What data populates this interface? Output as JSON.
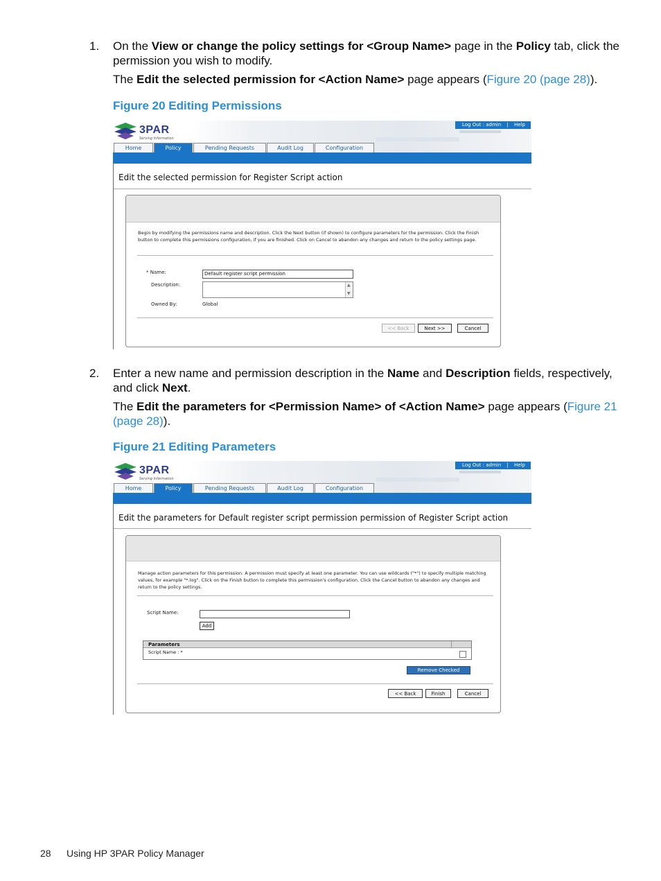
{
  "step1": {
    "num": "1.",
    "t1": "On the ",
    "b1": "View or change the policy settings for <Group Name>",
    "t2": " page in the ",
    "b2": "Policy",
    "t3": " tab, click the",
    "line2": "permission you wish to modify.",
    "r_t1": "The ",
    "r_b1": "Edit the selected permission for <Action Name>",
    "r_t2": " page appears (",
    "r_link": "Figure 20 (page 28)",
    "r_t3": ")."
  },
  "fig20": {
    "caption": "Figure 20 Editing Permissions",
    "logo_text": "3PAR",
    "logo_tag": "Serving Information",
    "toplinks": {
      "logout": "Log Out : admin",
      "divider": "|",
      "help": "Help"
    },
    "tabs": [
      "Home",
      "Policy",
      "Pending Requests",
      "Audit Log",
      "Configuration"
    ],
    "active_tab": "Policy",
    "page_title": "Edit the selected permission for Register Script action",
    "intro": "Begin by modifying the permissions name and description. Click the Next button (if shown) to configure parameters for the permission. Click the Finish button to complete this permissions configuration, if you are finished. Click on Cancel to abandon any changes and return to the policy settings page.",
    "name_label": "* Name:",
    "name_value": "Default register script permission",
    "desc_label": "Description:",
    "owned_label": "Owned By:",
    "owned_value": "Global",
    "buttons": {
      "back": "<< Back",
      "next": "Next >>",
      "cancel": "Cancel"
    }
  },
  "step2": {
    "num": "2.",
    "t1": "Enter a new name and permission description in the ",
    "b1": "Name",
    "t2": " and ",
    "b2": "Description",
    "t3": " fields, respectively,",
    "l2a": "and click ",
    "l2b": "Next",
    "l2c": ".",
    "r_t1": "The ",
    "r_b1": "Edit the parameters for <Permission Name> of <Action Name>",
    "r_t2": " page appears (",
    "r_link1": "Figure 21",
    "r_link2": "(page 28)",
    "r_t3": ")."
  },
  "fig21": {
    "caption": "Figure 21 Editing Parameters",
    "logo_text": "3PAR",
    "logo_tag": "Serving Information",
    "toplinks": {
      "logout": "Log Out : admin",
      "divider": "|",
      "help": "Help"
    },
    "tabs": [
      "Home",
      "Policy",
      "Pending Requests",
      "Audit Log",
      "Configuration"
    ],
    "active_tab": "Policy",
    "page_title": "Edit the parameters for Default register script permission permission of Register Script action",
    "intro": "Manage action parameters for this permission. A permission must specify at least one parameter. You can use wildcards (\"*\") to specify multiple matching values, for example \"*.log\". Click on the Finish button to complete this permission's configuration. Click the Cancel button to abandon any changes and return to the policy settings.",
    "script_label": "Script Name:",
    "add_button": "Add",
    "table_header": "Parameters",
    "table_row": "Script Name : *",
    "remove_button": "Remove Checked",
    "buttons": {
      "back": "<< Back",
      "finish": "Finish",
      "cancel": "Cancel"
    }
  },
  "footer": {
    "page_number": "28",
    "title": "Using HP 3PAR Policy Manager"
  }
}
